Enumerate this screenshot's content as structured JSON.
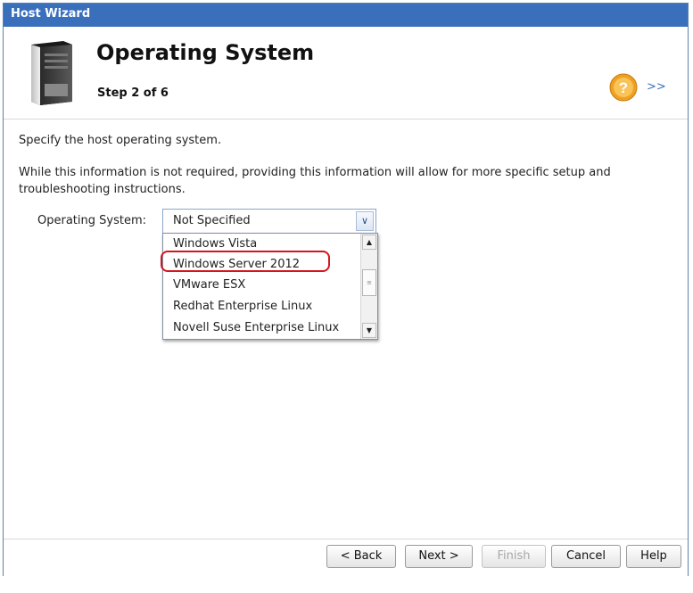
{
  "window": {
    "title": "Host Wizard"
  },
  "header": {
    "title": "Operating System",
    "step": "Step 2 of 6",
    "next_link": ">>"
  },
  "content": {
    "intro": "Specify the host operating system.",
    "detail": "While this information is not required, providing this information will allow for more specific setup and troubleshooting instructions.",
    "os_label": "Operating System:"
  },
  "os_select": {
    "selected": "Not Specified",
    "options": [
      "Windows Vista",
      "Windows Server 2012",
      "VMware ESX",
      "Redhat Enterprise Linux",
      "Novell Suse Enterprise Linux"
    ],
    "highlighted": "Windows Server 2012",
    "highlight_color": "#d4151c"
  },
  "footer": {
    "back": "< Back",
    "next": "Next >",
    "finish": "Finish",
    "cancel": "Cancel",
    "help": "Help"
  },
  "colors": {
    "titlebar": "#3a6fbc",
    "help_icon": "#f0a020"
  }
}
